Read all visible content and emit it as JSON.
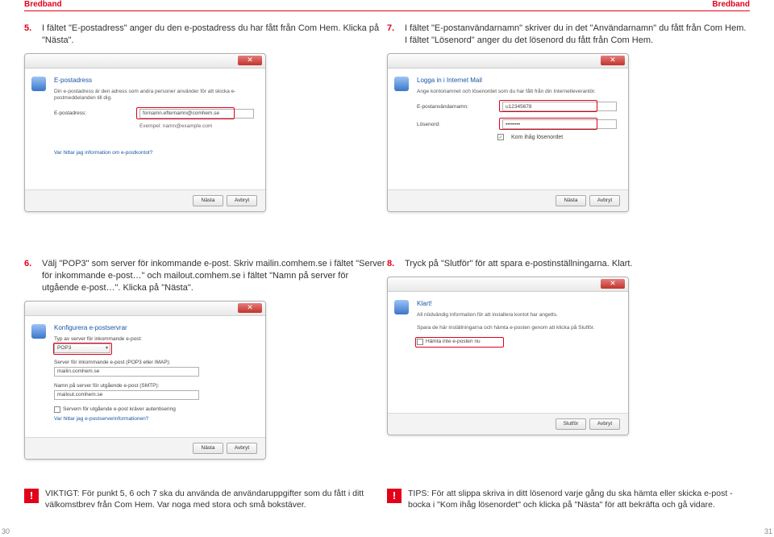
{
  "header": {
    "label_left": "Bredband",
    "label_right": "Bredband"
  },
  "steps": {
    "s5": {
      "num": "5.",
      "text": "I fältet \"E-postadress\" anger du den e-postadress du har fått från Com Hem. Klicka på \"Nästa\"."
    },
    "s6": {
      "num": "6.",
      "text": "Välj \"POP3\" som server för inkommande e-post. Skriv mailin.comhem.se i fältet \"Server för inkommande e-post…\" och mailout.comhem.se i fältet \"Namn på server för utgående e-post…\". Klicka på \"Nästa\"."
    },
    "s7": {
      "num": "7.",
      "text": "I fältet \"E-postanvändarnamn\" skriver du in det \"Användarnamn\" du fått från Com Hem. I fältet \"Lösenord\" anger du det lösenord du fått från Com Hem."
    },
    "s8": {
      "num": "8.",
      "text": "Tryck på \"Slutför\" för att spara e-postinställningarna. Klart."
    }
  },
  "notes": {
    "left": {
      "mark": "!",
      "text": "VIKTIGT: För punkt 5, 6 och 7 ska du använda de användaruppgifter som du fått i ditt välkomstbrev från Com Hem. Var noga med stora och små bokstäver."
    },
    "right": {
      "mark": "!",
      "text": "TIPS: För att slippa skriva in ditt lösenord varje gång du ska hämta eller skicka e-post -bocka i \"Kom ihåg lösenordet\" och klicka på \"Nästa\" för att bekräfta och gå vidare."
    }
  },
  "win5": {
    "title": "E-postadress",
    "desc": "Din e-postadress är den adress som andra personer använder för att skicka e-postmeddelanden till dig.",
    "label_addr": "E-postadress:",
    "value_addr": "fornamn.efternamn@comhem.se",
    "example": "Exempel: namn@example.com",
    "link": "Var hittar jag information om e-postkontot?",
    "btn_next": "Nästa",
    "btn_cancel": "Avbryt"
  },
  "win6": {
    "title": "Konfigurera e-postservrar",
    "label_type": "Typ av server för inkommande e-post:",
    "value_type": "POP3",
    "label_in": "Server för inkommande e-post (POP3 eller IMAP):",
    "value_in": "mailin.comhem.se",
    "label_out": "Namn på server för utgående e-post (SMTP):",
    "value_out": "mailout.comhem.se",
    "auth_chk": "Servern för utgående e-post kräver autentisering",
    "link": "Var hittar jag e-postserverinformationen?",
    "btn_next": "Nästa",
    "btn_cancel": "Avbryt"
  },
  "win7": {
    "title": "Logga in i Internet Mail",
    "desc": "Ange kontonamnet och lösenordet som du har fått från din Internetleverantör.",
    "label_user": "E-postanvändarnamn:",
    "value_user": "u12345678",
    "label_pw": "Lösenord:",
    "value_pw": "••••••••",
    "remember": "Kom ihåg lösenordet",
    "btn_next": "Nästa",
    "btn_cancel": "Avbryt"
  },
  "win8": {
    "title": "Klart!",
    "desc1": "All nödvändig information för att installera kontot har angetts.",
    "desc2": "Spara de här inställningarna och hämta e-posten genom att klicka på Slutför.",
    "fetch_chk": "Hämta inte e-posten nu",
    "btn_finish": "Slutför",
    "btn_cancel": "Avbryt"
  },
  "page": {
    "left": "30",
    "right": "31"
  }
}
